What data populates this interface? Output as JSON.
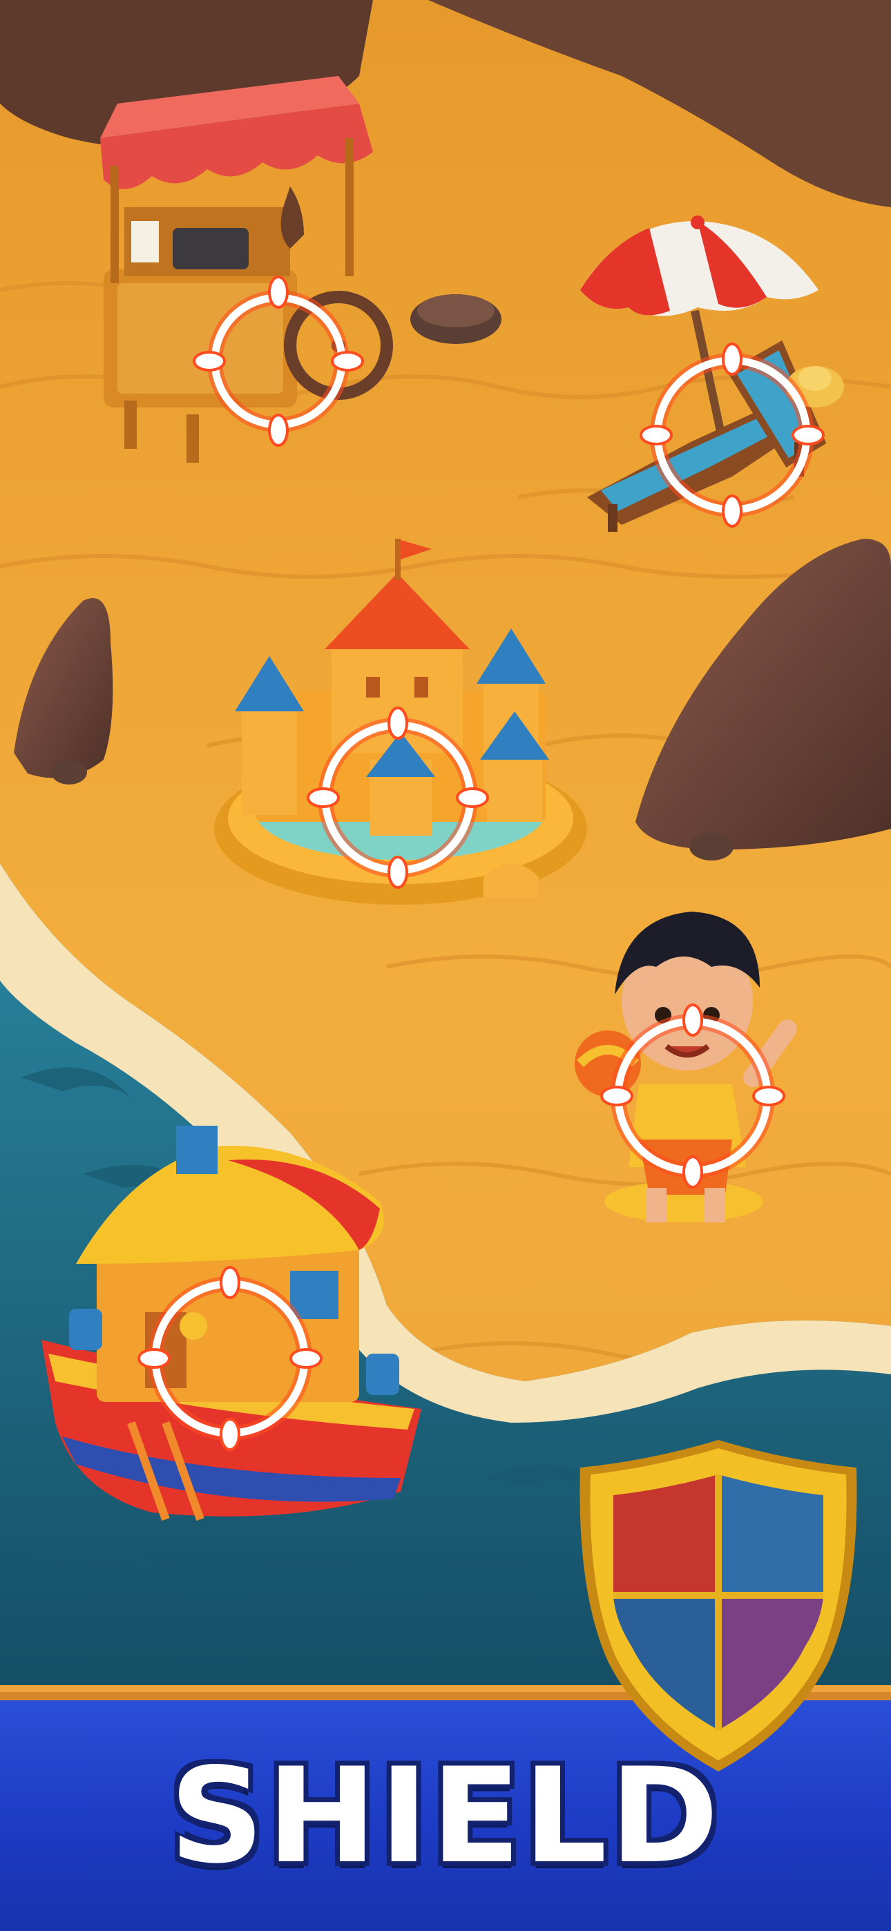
{
  "banner": {
    "title": "SHIELD",
    "background_color": "#1d3bc4",
    "border_color": "#d6872a"
  },
  "scene": {
    "sand_color": "#f0a93a",
    "water_color": "#1f6f7f",
    "target_marker_color": "#ff4b1f",
    "targets": [
      {
        "name": "coffee-cart-target",
        "object": "coffee-cart"
      },
      {
        "name": "beach-chair-target",
        "object": "beach-lounge-chair"
      },
      {
        "name": "sandcastle-target",
        "object": "sandcastle"
      },
      {
        "name": "boy-target",
        "object": "boy-with-ball"
      },
      {
        "name": "houseboat-target",
        "object": "houseboat"
      }
    ]
  },
  "shield": {
    "icon": "shield-icon",
    "quadrant_colors": [
      "#c4362e",
      "#2f6ea8",
      "#2a5f98",
      "#7b3f84"
    ],
    "frame_color": "#f2c024"
  }
}
